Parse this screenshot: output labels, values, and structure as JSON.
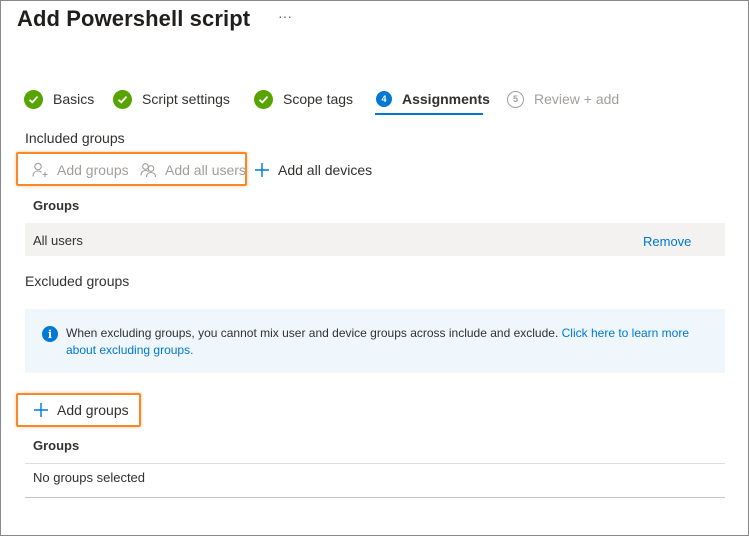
{
  "header": {
    "title": "Add Powershell script",
    "more": "···"
  },
  "wizard": {
    "steps": [
      {
        "label": "Basics",
        "state": "done"
      },
      {
        "label": "Script settings",
        "state": "done"
      },
      {
        "label": "Scope tags",
        "state": "done"
      },
      {
        "number": "4",
        "label": "Assignments",
        "state": "active"
      },
      {
        "number": "5",
        "label": "Review + add",
        "state": "todo"
      }
    ]
  },
  "included": {
    "label": "Included groups",
    "commands": {
      "add_groups": "Add groups",
      "add_all_users": "Add all users",
      "add_all_devices": "Add all devices"
    },
    "table": {
      "header": "Groups",
      "rows": [
        {
          "name": "All users",
          "action": "Remove"
        }
      ]
    }
  },
  "excluded": {
    "label": "Excluded groups",
    "info": {
      "text": "When excluding groups, you cannot mix user and device groups across include and exclude.",
      "link": "Click here to learn more about excluding groups."
    },
    "add_groups": "Add groups",
    "table": {
      "header": "Groups",
      "empty": "No groups selected"
    }
  },
  "colors": {
    "accent": "#0078d4",
    "success": "#57a300",
    "highlight": "#f7892a",
    "info_bg": "#eff6fc"
  },
  "icons": {
    "step_done": "checkmark-circle-icon",
    "add_groups": "add-person-icon",
    "add_all_users": "people-icon",
    "add_all_devices": "plus-icon",
    "info": "info-icon"
  }
}
